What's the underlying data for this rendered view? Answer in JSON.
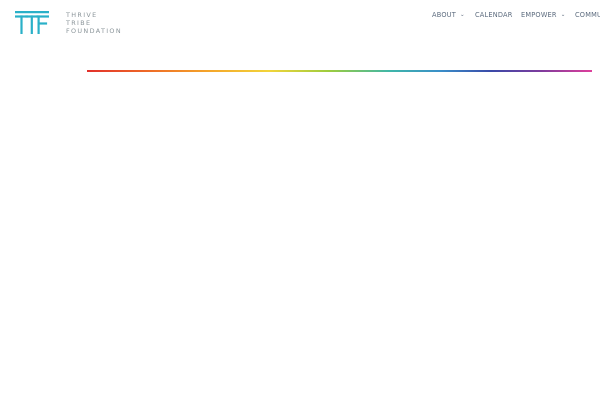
{
  "brand": {
    "name_lines": [
      "THRIVE",
      "TRIBE",
      "FOUNDATION"
    ],
    "accent_color": "#2ab0c8"
  },
  "nav": {
    "items": [
      {
        "label": "ABOUT",
        "has_dropdown": true
      },
      {
        "label": "CALENDAR",
        "has_dropdown": false
      },
      {
        "label": "EMPOWER",
        "has_dropdown": true
      },
      {
        "label": "COMMU",
        "has_dropdown": false
      }
    ],
    "dropdown_icon": "chevron-down-icon",
    "text_color": "#5c6b7e"
  },
  "divider": {
    "style": "rainbow-gradient",
    "colors": [
      "#e2302b",
      "#ee6a27",
      "#f4a52a",
      "#f2d43a",
      "#9ccc3e",
      "#3fb6a9",
      "#3a8ec9",
      "#3a4aa8",
      "#7f3b9d",
      "#de3f9b"
    ]
  }
}
